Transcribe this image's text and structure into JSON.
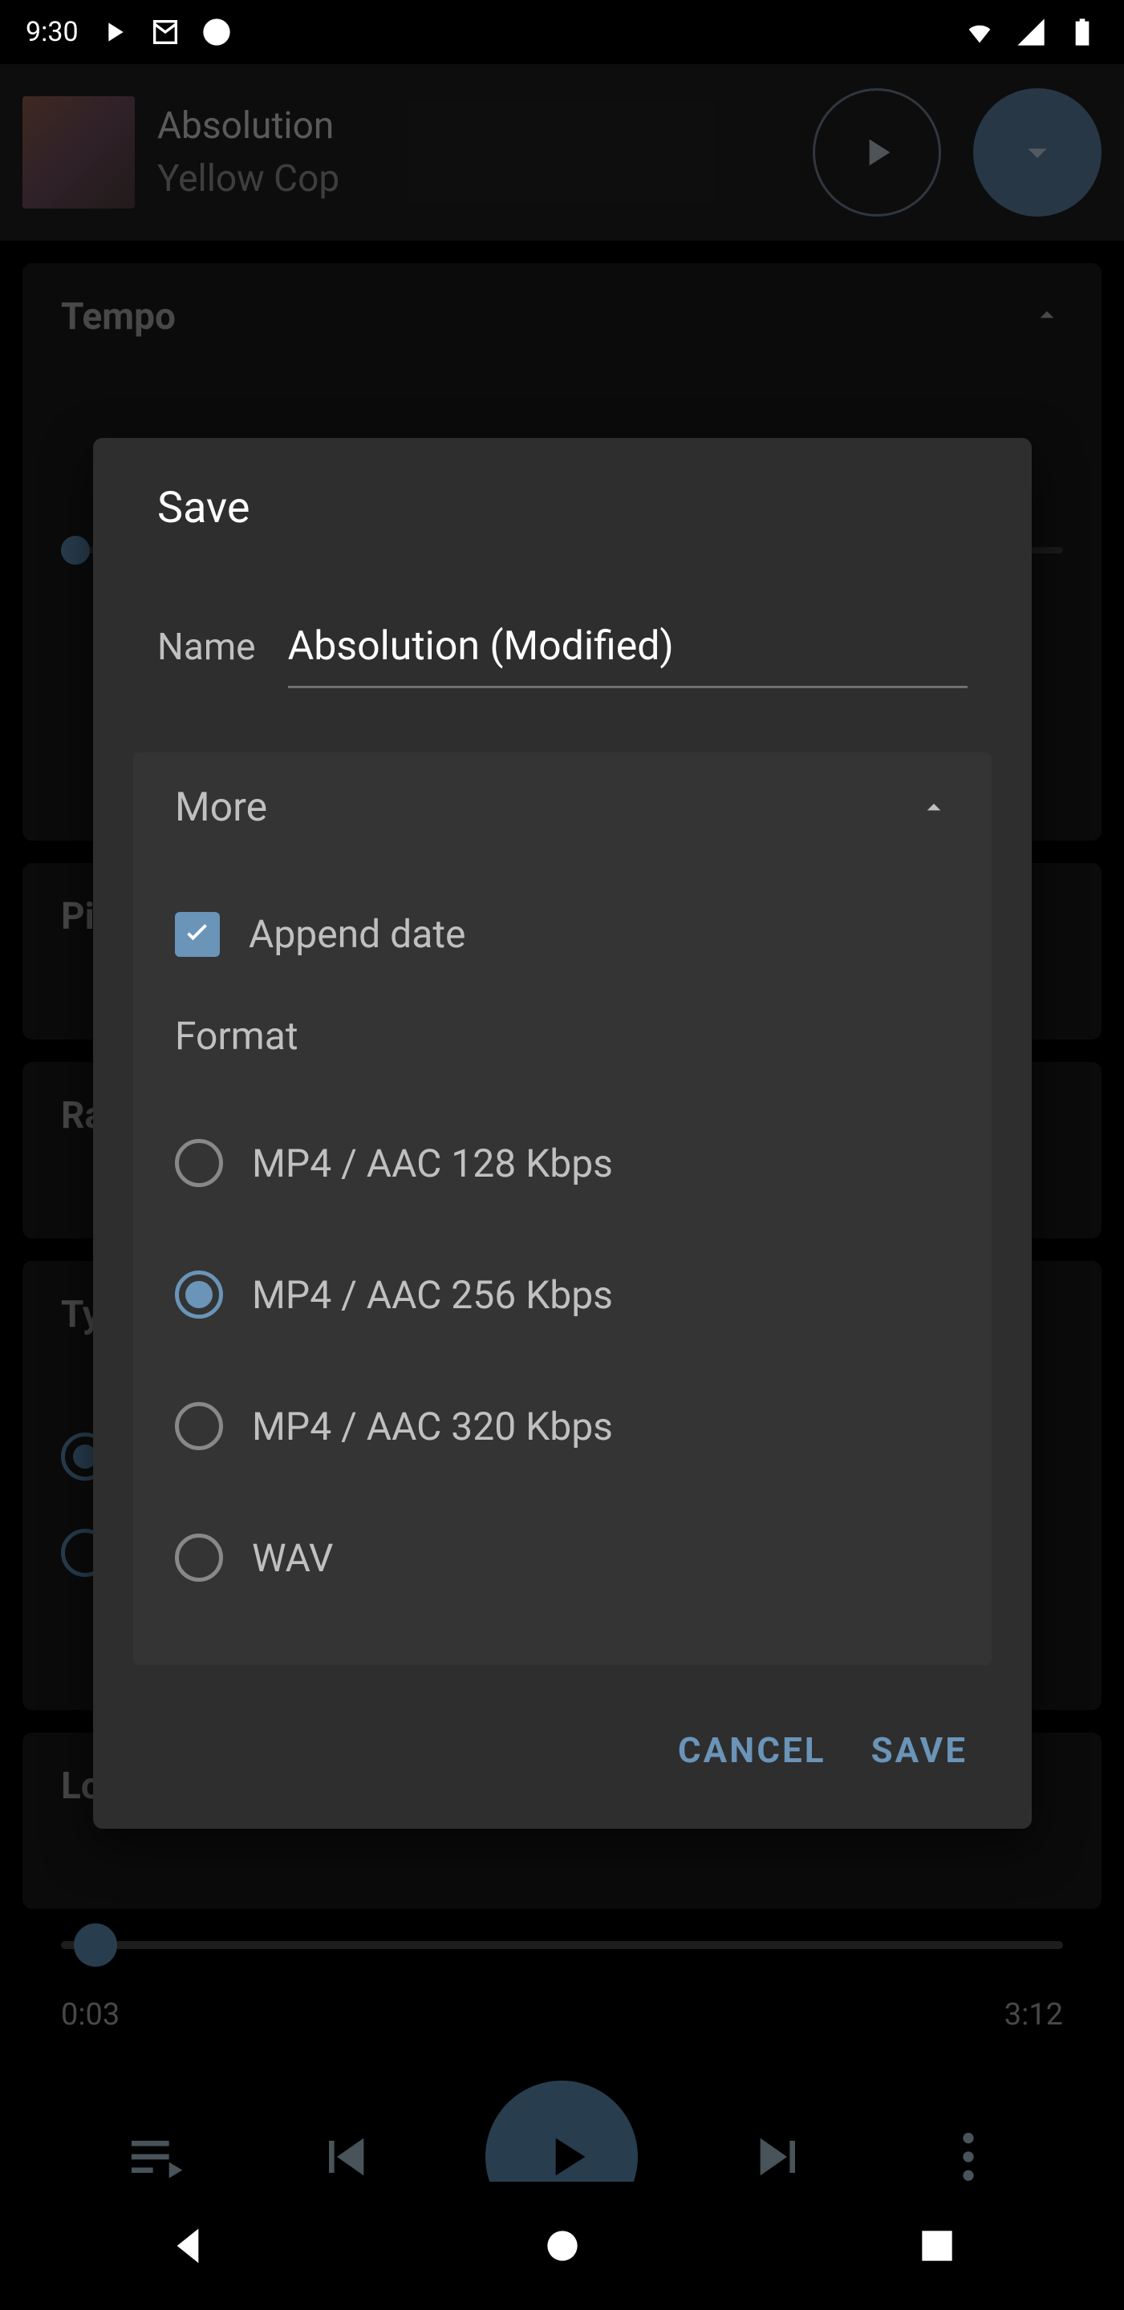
{
  "statusbar": {
    "time": "9:30"
  },
  "miniplayer": {
    "title": "Absolution",
    "artist": "Yellow Cop"
  },
  "background": {
    "panels": [
      {
        "title": "Tempo"
      },
      {
        "title": "Pi"
      },
      {
        "title": "Ra"
      },
      {
        "title": "Ty"
      },
      {
        "title": "Lo"
      }
    ],
    "progress": {
      "current": "0:03",
      "total": "3:12"
    }
  },
  "dialog": {
    "title": "Save",
    "name_label": "Name",
    "name_value": "Absolution (Modified)",
    "more": {
      "label": "More",
      "append_date_label": "Append date",
      "append_date_checked": true,
      "format_label": "Format",
      "options": [
        {
          "label": "MP4 / AAC 128 Kbps",
          "selected": false
        },
        {
          "label": "MP4 / AAC 256 Kbps",
          "selected": true
        },
        {
          "label": "MP4 / AAC 320 Kbps",
          "selected": false
        },
        {
          "label": "WAV",
          "selected": false
        }
      ]
    },
    "actions": {
      "cancel": "CANCEL",
      "save": "SAVE"
    }
  }
}
